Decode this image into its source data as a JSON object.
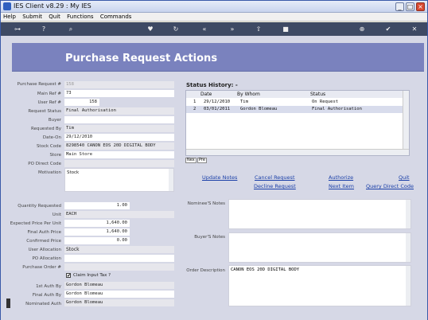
{
  "window": {
    "title": "IES Client v8.29 : My IES"
  },
  "menu": [
    "Help",
    "Submit",
    "Quit",
    "Functions",
    "Commands"
  ],
  "toolbar_icons": [
    "key-icon",
    "help-icon",
    "search-icon",
    "heart-icon",
    "refresh-icon",
    "rewind-icon",
    "fast-forward-icon",
    "upload-icon",
    "stop-icon",
    "add-icon",
    "confirm-icon",
    "close-icon"
  ],
  "page_title": "Purchase Request Actions",
  "form": {
    "purchase_request_label": "Purchase Request #",
    "purchase_request": "158",
    "main_ref_label": "Main Ref #",
    "main_ref": "73",
    "user_ref_label": "User Ref #",
    "user_ref": "158",
    "request_status_label": "Request Status",
    "request_status": "Final Authorisation",
    "buyer_label": "Buyer",
    "buyer": "",
    "requested_by_label": "Requested By",
    "requested_by": "Tim",
    "date_on_label": "Date-On",
    "date_on": "29/12/2010",
    "stock_code_label": "Stock Code",
    "stock_code": "8298540 CANON EOS 20D DIGITAL BODY",
    "store_label": "Store",
    "store": "Main Store",
    "po_direct_code_label": "PO Direct Code",
    "po_direct_code": "",
    "motivation_label": "Motivation",
    "motivation": "Stock",
    "quantity_requested_label": "Quantity Requested",
    "quantity_requested": "1.00",
    "unit_label": "Unit",
    "unit": "EACH",
    "expected_price_label": "Expected Price Per Unit",
    "expected_price": "1,640.00",
    "final_auth_price_label": "Final Auth Price",
    "final_auth_price": "1,640.00",
    "confirmed_price_label": "Confirmed Price",
    "confirmed_price": "0.00",
    "user_allocation_label": "User Allocation",
    "user_allocation": "Stock",
    "po_allocation_label": "PO Allocation",
    "po_allocation": "",
    "purchase_order_label": "Purchase Order #",
    "purchase_order": "",
    "claim_input_tax_label": "Claim Input Tax ?",
    "claim_input_tax_checked": "✔",
    "first_auth_label": "1st Auth By",
    "first_auth": "Gordon Blomeau",
    "final_auth_label": "Final Auth By",
    "final_auth": "Gordon Blomeau",
    "nominated_auth_label": "Nominated Auth",
    "nominated_auth": "Gordon Blomeau"
  },
  "status_history": {
    "title": "Status History: -",
    "columns": [
      "Date",
      "By Whom",
      "Status"
    ],
    "rows": [
      {
        "n": "1",
        "date": "29/12/2010",
        "by": "Tim",
        "status": "On Request"
      },
      {
        "n": "2",
        "date": "03/01/2011",
        "by": "Gordon Blomeau",
        "status": "Final Authorisation"
      }
    ],
    "nav_prev": "Nex",
    "nav_next": "Pre"
  },
  "actions": {
    "update_notes": "Update Notes",
    "cancel_request": "Cancel Request",
    "authorize": "Authorize",
    "quit": "Quit",
    "decline_request": "Decline Request",
    "next_item": "Next Item",
    "query_direct_code": "Query Direct Code"
  },
  "notes": {
    "nominee_label": "Nominee'S Notes",
    "nominee": "",
    "buyer_label": "Buyer'S Notes",
    "buyer": "",
    "order_description_label": "Order Description",
    "order_description": "CANON EOS 20D DIGITAL BODY"
  }
}
